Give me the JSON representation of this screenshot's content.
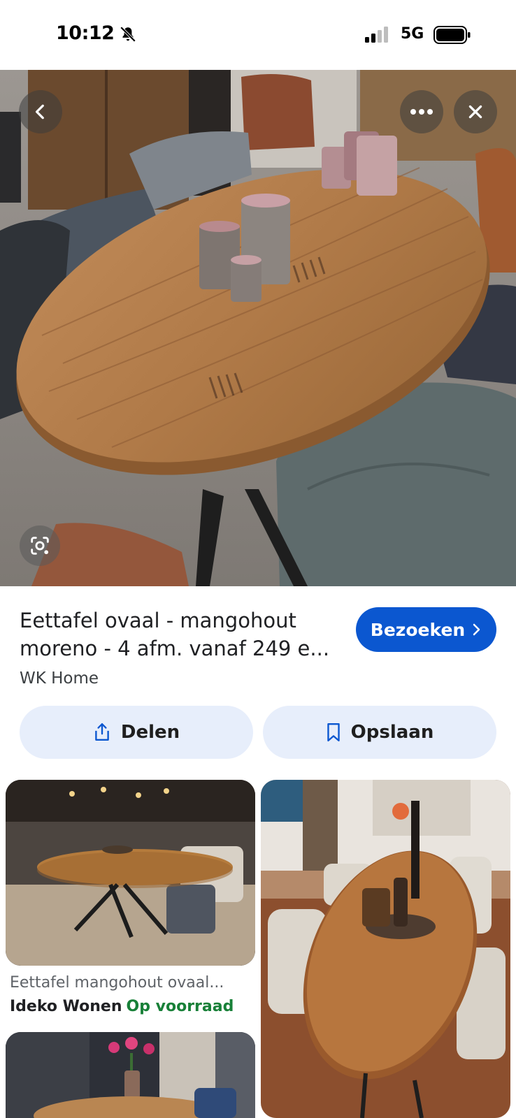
{
  "status_bar": {
    "time": "10:12",
    "network": "5G",
    "icons": [
      "bell-off-icon",
      "signal-icon",
      "battery-icon"
    ]
  },
  "hero": {
    "buttons": [
      "back-icon",
      "more-icon",
      "close-icon",
      "lens-icon"
    ]
  },
  "result": {
    "title_line1": "Eettafel ovaal - mangohout",
    "title_line2": "moreno - 4 afm. vanaf 249 e...",
    "source": "WK Home",
    "visit_label": "Bezoeken",
    "visit_icon": "chevron-right-icon"
  },
  "actions": {
    "share_label": "Delen",
    "share_icon": "share-icon",
    "save_label": "Opslaan",
    "save_icon": "bookmark-icon"
  },
  "related": [
    {
      "caption": "Eettafel mangohout ovaal...",
      "source": "Ideko Wonen",
      "stock": "Op voorraad"
    }
  ],
  "colors": {
    "primary": "#0b57d0",
    "chip_bg": "#e7eefb",
    "in_stock": "#188038"
  }
}
